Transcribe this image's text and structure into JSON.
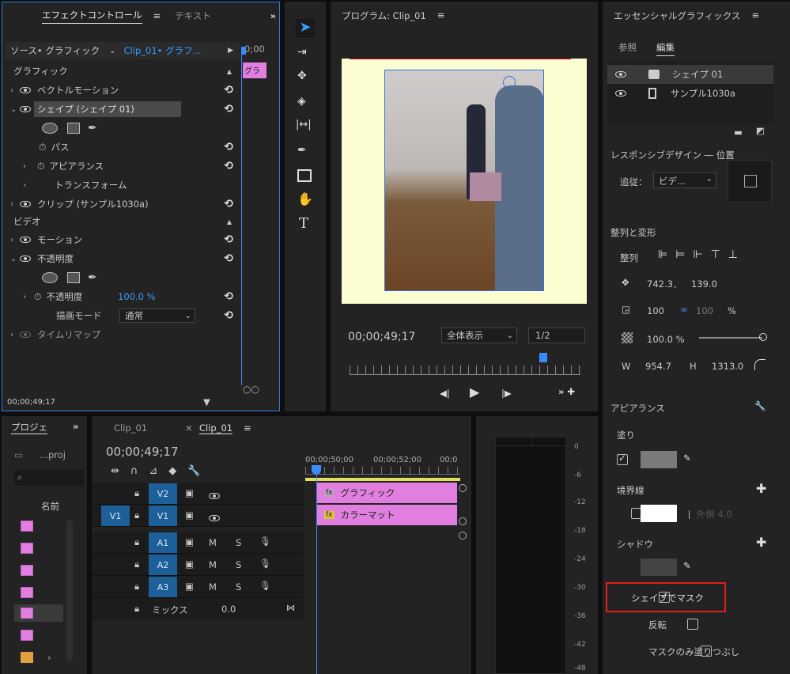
{
  "effect_controls": {
    "tab_active": "エフェクトコントロール",
    "tab_other": "テキスト",
    "source": "ソース• グラフィック",
    "clip": "Clip_01• グラフ...",
    "timecode_hdr": "0;00",
    "mini_clip": "グラ",
    "rows": [
      {
        "label": "グラフィック",
        "type": "section"
      },
      {
        "label": "ベクトルモーション"
      },
      {
        "label": "シェイプ (シェイプ 01)",
        "selected": true
      },
      {
        "label": "パス"
      },
      {
        "label": "アピアランス"
      },
      {
        "label": "トランスフォーム"
      },
      {
        "label": "クリップ (サンプル1030a)"
      },
      {
        "label": "ビデオ",
        "type": "section"
      },
      {
        "label": "モーション"
      },
      {
        "label": "不透明度"
      },
      {
        "label": "不透明度"
      },
      {
        "label": "描画モード"
      },
      {
        "label": "タイムリマップ"
      }
    ],
    "opacity_value": "100.0 %",
    "blend_mode": "通常",
    "timecode": "00;00;49;17"
  },
  "program": {
    "title": "プログラム: Clip_01",
    "timecode": "00;00;49;17",
    "zoom": "全体表示",
    "resolution": "1/2"
  },
  "essential": {
    "title": "エッセンシャルグラフィックス",
    "tab_browse": "参照",
    "tab_edit": "編集",
    "layers": [
      "シェイプ 01",
      "サンプル1030a"
    ],
    "responsive_label": "レスポンシブデザイン ― 位置",
    "follow_label": "追従：",
    "follow_value": "ビデ...",
    "align_label": "整列と変形",
    "align_row_label": "整列",
    "pos_x": "742.3",
    "pos_sep": ",",
    "pos_y": "139.0",
    "scale": "100",
    "scale2": "100",
    "scale_unit": "%",
    "opacity": "100.0 %",
    "w_label": "W",
    "w": "954.7",
    "h_label": "H",
    "h": "1313.0",
    "appearance": "アピアランス",
    "fill": "塗り",
    "stroke": "境界線",
    "stroke_pos": "外側",
    "stroke_val": "4.0",
    "shadow": "シャドウ",
    "mask_label": "シェイプでマスク",
    "invert": "反転",
    "fill_only": "マスクのみ塗りつぶし"
  },
  "project": {
    "title": "プロジェ",
    "file": "...proj",
    "col_name": "名前"
  },
  "timeline": {
    "tab1": "Clip_01",
    "tab2": "Clip_01",
    "timecode": "00;00;49;17",
    "ruler": [
      "00;00;50;00",
      "00;00;52;00",
      "00;0"
    ],
    "tracks": {
      "v2": "V2",
      "v1": "V1",
      "v1src": "V1",
      "a1": "A1",
      "a2": "A2",
      "a3": "A3",
      "mix": "ミックス",
      "mix_val": "0.0"
    },
    "clip_graphic": "グラフィック",
    "clip_matte": "カラーマット",
    "m": "M",
    "s": "S"
  },
  "meter": {
    "labels": [
      "0",
      "-6",
      "-12",
      "-18",
      "-24",
      "-30",
      "-36",
      "-42",
      "-48"
    ]
  }
}
